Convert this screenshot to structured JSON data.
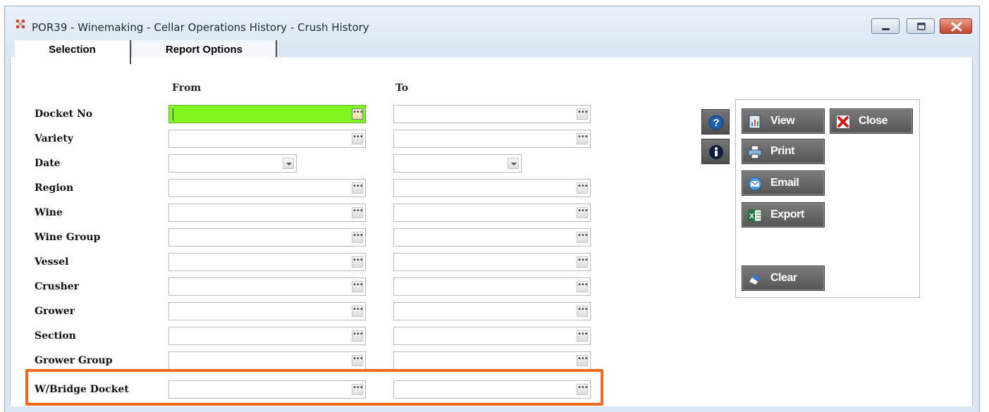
{
  "window": {
    "title": "POR39 - Winemaking - Cellar Operations History - Crush History"
  },
  "tabs": [
    {
      "label": "Selection",
      "selected": true
    },
    {
      "label": "Report Options",
      "selected": false
    }
  ],
  "columns": {
    "from": "From",
    "to": "To"
  },
  "rows": [
    {
      "label": "Docket No",
      "type": "lookup"
    },
    {
      "label": "Variety",
      "type": "lookup"
    },
    {
      "label": "Date",
      "type": "date"
    },
    {
      "label": "Region",
      "type": "lookup"
    },
    {
      "label": "Wine",
      "type": "lookup"
    },
    {
      "label": "Wine Group",
      "type": "lookup"
    },
    {
      "label": "Vessel",
      "type": "lookup"
    },
    {
      "label": "Crusher",
      "type": "lookup"
    },
    {
      "label": "Grower",
      "type": "lookup"
    },
    {
      "label": "Section",
      "type": "lookup"
    },
    {
      "label": "Grower Group",
      "type": "lookup"
    },
    {
      "label": "W/Bridge Docket",
      "type": "lookup"
    }
  ],
  "actions": {
    "view": "View",
    "close": "Close",
    "print": "Print",
    "email": "Email",
    "export": "Export",
    "clear": "Clear"
  },
  "icons": {
    "help": "question-icon",
    "info": "info-icon"
  },
  "colors": {
    "active_field": "#80f520",
    "highlight": "#ee6a1f",
    "button_bg": "#5f5f5f"
  }
}
